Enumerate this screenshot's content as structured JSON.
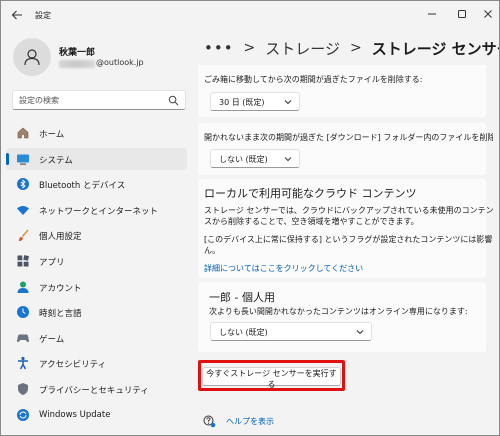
{
  "window": {
    "app_title": "設定"
  },
  "profile": {
    "name": "秋葉一郎",
    "email_suffix": "@outlook.jp"
  },
  "search": {
    "placeholder": "設定の検索"
  },
  "sidebar": {
    "items": [
      {
        "label": "ホーム",
        "icon": "home-icon"
      },
      {
        "label": "システム",
        "icon": "system-icon",
        "active": true
      },
      {
        "label": "Bluetooth とデバイス",
        "icon": "bluetooth-icon"
      },
      {
        "label": "ネットワークとインターネット",
        "icon": "network-icon"
      },
      {
        "label": "個人用設定",
        "icon": "brush-icon"
      },
      {
        "label": "アプリ",
        "icon": "apps-icon"
      },
      {
        "label": "アカウント",
        "icon": "account-icon"
      },
      {
        "label": "時刻と言語",
        "icon": "time-language-icon"
      },
      {
        "label": "ゲーム",
        "icon": "game-icon"
      },
      {
        "label": "アクセシビリティ",
        "icon": "accessibility-icon"
      },
      {
        "label": "プライバシーとセキュリティ",
        "icon": "shield-icon"
      },
      {
        "label": "Windows Update",
        "icon": "update-icon"
      }
    ]
  },
  "breadcrumb": {
    "more": "•••",
    "separator": ">",
    "parent": "ストレージ",
    "current": "ストレージ センサー"
  },
  "main": {
    "recycle_label": "ごみ箱に移動してから次の期間が過ぎたファイルを削除する:",
    "recycle_value": "30 日 (既定)",
    "downloads_label": "開かれないまま次の期間が過ぎた [ダウンロード] フォルダー内のファイルを削除する:",
    "downloads_value": "しない (既定)",
    "cloud_title": "ローカルで利用可能なクラウド コンテンツ",
    "cloud_desc_1": "ストレージ センサーでは、クラウドにバックアップされている未使用のコンテンツをデバイ",
    "cloud_desc_2": "スから削除することで、空き領域を増やすことができます。",
    "cloud_note_1": "[このデバイス上に常に保持する] というフラグが設定されたコンテンツには影響しませ",
    "cloud_note_2": "ん。",
    "cloud_link": "詳細についてはここをクリックしてください",
    "personal_title": "一郎 - 個人用",
    "personal_label": "次よりも長い間開かれなかったコンテンツはオンライン専用になります:",
    "personal_value": "しない (既定)",
    "run_button": "今すぐストレージ センサーを実行する",
    "help_link": "ヘルプを表示"
  },
  "colors": {
    "accent": "#0067c0",
    "link": "#005fb8",
    "highlight": "#e01010"
  }
}
